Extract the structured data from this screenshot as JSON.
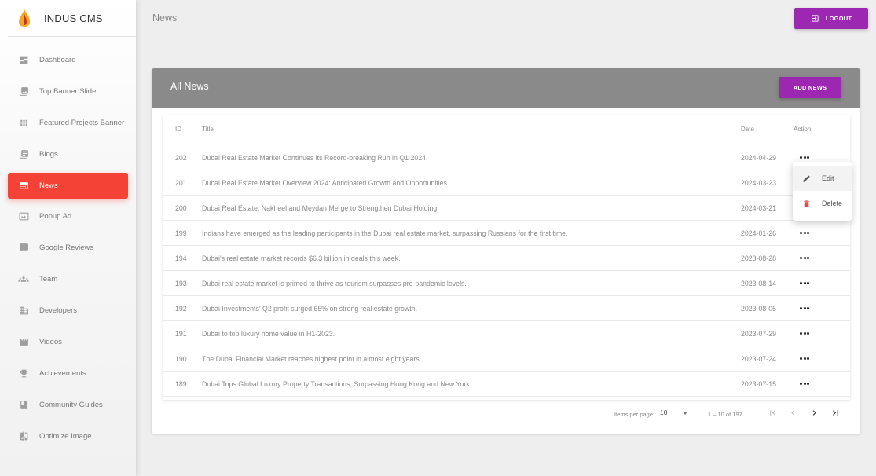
{
  "brand": {
    "title": "INDUS CMS"
  },
  "sidebar": {
    "items": [
      {
        "label": "Dashboard",
        "icon": "dashboard-icon"
      },
      {
        "label": "Top Banner Slider",
        "icon": "image-icon"
      },
      {
        "label": "Featured Projects Banner",
        "icon": "grid-icon"
      },
      {
        "label": "Blogs",
        "icon": "list-icon"
      },
      {
        "label": "News",
        "icon": "web-icon",
        "active": true
      },
      {
        "label": "Popup Ad",
        "icon": "popup-icon"
      },
      {
        "label": "Google Reviews",
        "icon": "review-icon"
      },
      {
        "label": "Team",
        "icon": "group-icon"
      },
      {
        "label": "Developers",
        "icon": "building-icon"
      },
      {
        "label": "Videos",
        "icon": "video-icon"
      },
      {
        "label": "Achievements",
        "icon": "trophy-icon"
      },
      {
        "label": "Community Guides",
        "icon": "book-icon"
      },
      {
        "label": "Optimize Image",
        "icon": "compare-icon"
      }
    ]
  },
  "header": {
    "page_title": "News",
    "logout_label": "LOGOUT"
  },
  "card": {
    "title": "All News",
    "add_label": "ADD NEWS"
  },
  "table": {
    "headers": {
      "id": "ID",
      "title": "Title",
      "date": "Date",
      "action": "Action"
    },
    "rows": [
      {
        "id": "202",
        "title": "Dubai Real Estate Market Continues its Record-breaking Run in Q1 2024",
        "date": "2024-04-29"
      },
      {
        "id": "201",
        "title": "Dubai Real Estate Market Overview 2024: Anticipated Growth and Opportunities",
        "date": "2024-03-23"
      },
      {
        "id": "200",
        "title": "Dubai Real Estate: Nakheel and Meydan Merge to Strengthen Dubai Holding",
        "date": "2024-03-21"
      },
      {
        "id": "199",
        "title": "Indians have emerged as the leading participants in the Dubai real estate market, surpassing Russians for the first time.",
        "date": "2024-01-26"
      },
      {
        "id": "194",
        "title": "Dubai's real estate market records $6.3 billion in deals this week.",
        "date": "2023-08-28"
      },
      {
        "id": "193",
        "title": "Dubai real estate market is primed to thrive as tourism surpasses pre-pandemic levels.",
        "date": "2023-08-14"
      },
      {
        "id": "192",
        "title": "Dubai Investments' Q2 profit surged 65% on strong real estate growth.",
        "date": "2023-08-05"
      },
      {
        "id": "191",
        "title": "Dubai to top luxury home value in H1-2023.",
        "date": "2023-07-29"
      },
      {
        "id": "190",
        "title": "The Dubai Financial Market reaches highest point in almost eight years.",
        "date": "2023-07-24"
      },
      {
        "id": "189",
        "title": "Dubai Tops Global Luxury Property Transactions, Surpassing Hong Kong and New York.",
        "date": "2023-07-15"
      }
    ]
  },
  "paginator": {
    "items_per_page_label": "Items per page:",
    "page_size": "10",
    "range_label": "1 – 10 of 197"
  },
  "action_menu": {
    "items": [
      {
        "label": "Edit",
        "icon": "pencil-icon"
      },
      {
        "label": "Delete",
        "icon": "trash-icon",
        "color": "#f44336"
      }
    ]
  },
  "colors": {
    "accent": "#9c27b0",
    "active": "#f44336",
    "header_gray": "#8a8a8a"
  }
}
